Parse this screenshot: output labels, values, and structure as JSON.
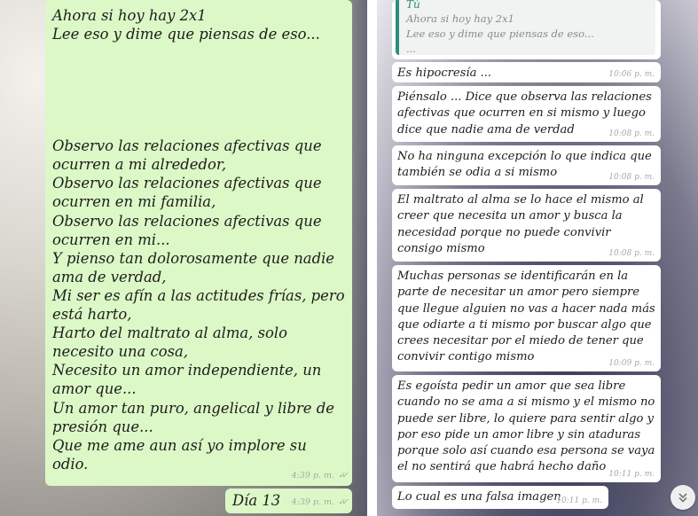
{
  "left": {
    "big_message": {
      "line1": "Ahora si hoy hay 2x1",
      "line2": "Lee eso y dime que piensas de eso...",
      "poem": [
        "Observo las relaciones afectivas que ocurren a mi alrededor,",
        "Observo las relaciones afectivas que ocurren en mi familia,",
        "Observo las relaciones afectivas que ocurren en mi...",
        "Y pienso tan dolorosamente que nadie ama de verdad,",
        "Mi ser es afín a las actitudes frías, pero está harto,",
        "Harto del maltrato al alma, solo necesito una cosa,",
        "Necesito un amor independiente, un amor que...",
        "Un amor tan puro, angelical y libre de presión que...",
        "Que me ame aun así yo implore su odio."
      ],
      "time": "4:39 p. m."
    },
    "day_message": {
      "text": "Día 13",
      "time": "4:39 p. m."
    }
  },
  "right": {
    "quote": {
      "author": "Tú",
      "line1": "Ahora si hoy hay 2x1",
      "line2": "Lee eso y dime que piensas de eso...",
      "line3": "..."
    },
    "messages": [
      {
        "text": "Es hipocresía ...",
        "time": "10:06 p. m."
      },
      {
        "text": "Piénsalo ... Dice que observa las relaciones afectivas que ocurren en si mismo y luego dice que nadie ama de verdad",
        "time": "10:08 p. m."
      },
      {
        "text": "No ha ninguna excepción lo que indica que también se odia a si mismo",
        "time": "10:08 p. m."
      },
      {
        "text": "El maltrato al alma se lo hace el mismo al creer que necesita un amor y busca la necesidad porque no puede convivir consigo mismo",
        "time": "10:08 p. m."
      },
      {
        "text": "Muchas personas se identificarán en la parte de necesitar un amor pero siempre que llegue alguien no vas a hacer nada más que odiarte a ti mismo por buscar algo que crees necesitar por el miedo de tener que convivir contigo mismo",
        "time": "10:09 p. m."
      },
      {
        "text": "Es egoísta pedir un amor que sea libre cuando no se ama a si mismo y el mismo no puede ser libre, lo quiere para sentir algo y por eso pide un amor libre y sin ataduras porque solo así cuando esa persona se vaya el no sentirá que habrá hecho daño",
        "time": "10:11 p. m."
      },
      {
        "text": "Lo cual es una falsa imagen",
        "time": "10:11 p. m."
      }
    ],
    "scroll_icon": "chevron-double-down-icon"
  },
  "colors": {
    "outgoing": "#dcf8c6",
    "incoming": "#ffffff",
    "quote_accent": "#2a8f7c"
  }
}
